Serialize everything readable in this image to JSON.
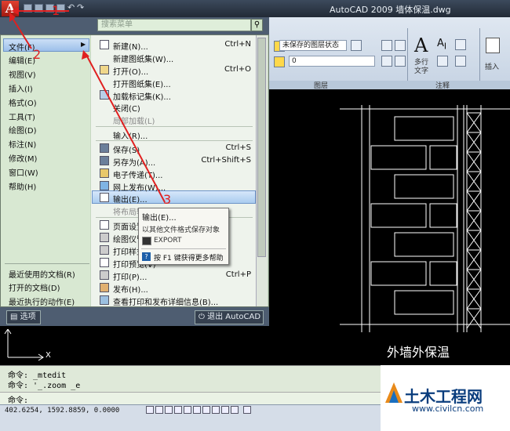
{
  "window": {
    "title": "AutoCAD 2009  墙体保温.dwg",
    "logo_letter": "A"
  },
  "menu": {
    "search_placeholder": "搜索菜单",
    "left_items": [
      {
        "label": "文件(F)",
        "arrow": "▶"
      },
      {
        "label": "编辑(E)"
      },
      {
        "label": "视图(V)"
      },
      {
        "label": "插入(I)"
      },
      {
        "label": "格式(O)"
      },
      {
        "label": "工具(T)"
      },
      {
        "label": "绘图(D)"
      },
      {
        "label": "标注(N)"
      },
      {
        "label": "修改(M)"
      },
      {
        "label": "窗口(W)"
      },
      {
        "label": "帮助(H)"
      }
    ],
    "left_bottom": [
      "最近使用的文档(R)",
      "打开的文档(D)",
      "最近执行的动作(E)"
    ],
    "right_items": [
      {
        "label": "新建(N)...",
        "shortcut": "Ctrl+N"
      },
      {
        "label": "新建图纸集(W)..."
      },
      {
        "label": "打开(O)...",
        "shortcut": "Ctrl+O"
      },
      {
        "label": "打开图纸集(E)..."
      },
      {
        "label": "加载标记集(K)..."
      },
      {
        "label": "关闭(C)"
      },
      {
        "label": "局部加载(L)"
      },
      {
        "label": "输入(R)..."
      },
      {
        "label": "保存(S)",
        "shortcut": "Ctrl+S"
      },
      {
        "label": "另存为(A)...",
        "shortcut": "Ctrl+Shift+S"
      },
      {
        "label": "电子传递(T)..."
      },
      {
        "label": "网上发布(W)..."
      },
      {
        "label": "输出(E)..."
      },
      {
        "label": "将布局输出到模型空间..."
      },
      {
        "label": "页面设置管理器(G)..."
      },
      {
        "label": "绘图仪管理器(M)..."
      },
      {
        "label": "打印样式管理器(Y)..."
      },
      {
        "label": "打印预览(V)"
      },
      {
        "label": "打印(P)...",
        "shortcut": "Ctrl+P"
      },
      {
        "label": "发布(H)..."
      },
      {
        "label": "查看打印和发布详细信息(B)..."
      }
    ],
    "options_button": "选项",
    "exit_button": "退出 AutoCAD"
  },
  "submenu": {
    "title": "输出(E)...",
    "description": "以其他文件格式保存对象",
    "command": "EXPORT",
    "help": "按 F1 键获得更多帮助"
  },
  "annotations": {
    "n1": "1",
    "n2": "2",
    "n3": "3"
  },
  "ribbon": {
    "layer_state": "未保存的图层状态",
    "layer_name": "0",
    "panel_layers": "图层",
    "panel_annotation": "注释",
    "text_label": "多行\n文字",
    "text_label_1": "多行",
    "text_label_2": "文字",
    "insert_label": "插入"
  },
  "drawing": {
    "caption": "外墙外保温",
    "axis_x": "X"
  },
  "command_line": {
    "lines": [
      "命令: _mtedit",
      "命令: '_.zoom _e"
    ],
    "prompt": "命令:"
  },
  "status": {
    "coords": "402.6254,  1592.8859, 0.0000"
  },
  "watermark": {
    "name": "土木工程网",
    "url": "www.civilcn.com"
  }
}
